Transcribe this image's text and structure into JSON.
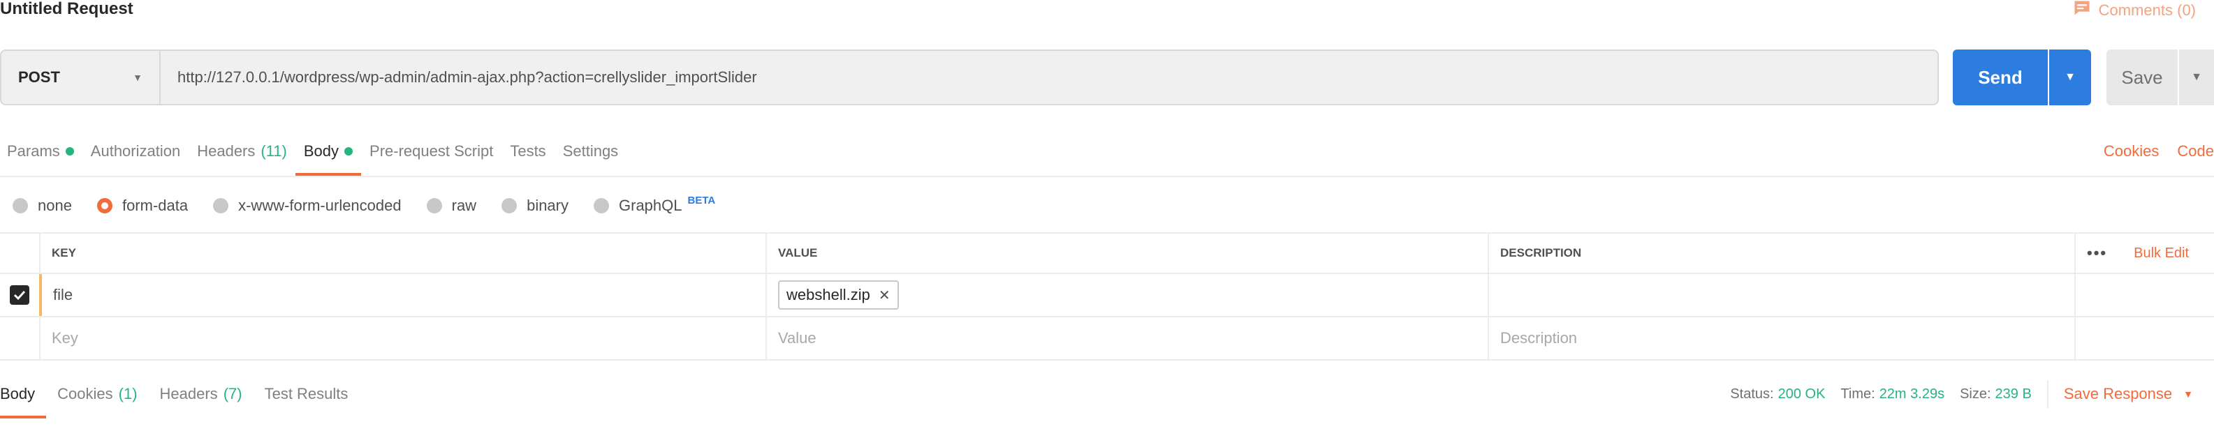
{
  "request": {
    "title": "Untitled Request",
    "comments_label": "Comments (0)"
  },
  "url_bar": {
    "method": "POST",
    "url": "http://127.0.0.1/wordpress/wp-admin/admin-ajax.php?action=crellyslider_importSlider",
    "send_label": "Send",
    "save_label": "Save"
  },
  "request_tabs": [
    {
      "label": "Params",
      "dot": true
    },
    {
      "label": "Authorization"
    },
    {
      "label": "Headers",
      "count": "(11)"
    },
    {
      "label": "Body",
      "dot": true,
      "active": true
    },
    {
      "label": "Pre-request Script"
    },
    {
      "label": "Tests"
    },
    {
      "label": "Settings"
    }
  ],
  "right_links": {
    "cookies": "Cookies",
    "code": "Code"
  },
  "body_types": [
    {
      "label": "none"
    },
    {
      "label": "form-data",
      "selected": true
    },
    {
      "label": "x-www-form-urlencoded"
    },
    {
      "label": "raw"
    },
    {
      "label": "binary"
    },
    {
      "label": "GraphQL",
      "badge": "BETA"
    }
  ],
  "params_table": {
    "headers": {
      "key": "KEY",
      "value": "VALUE",
      "description": "DESCRIPTION",
      "bulk_edit": "Bulk Edit",
      "more": "•••"
    },
    "rows": [
      {
        "key": "file",
        "value": "webshell.zip",
        "checked": true
      }
    ],
    "placeholders": {
      "key": "Key",
      "value": "Value",
      "description": "Description"
    }
  },
  "response_tabs": [
    {
      "label": "Body",
      "active": true
    },
    {
      "label": "Cookies",
      "count": "(1)"
    },
    {
      "label": "Headers",
      "count": "(7)"
    },
    {
      "label": "Test Results"
    }
  ],
  "response_status": {
    "status_label": "Status:",
    "status_value": "200 OK",
    "time_label": "Time:",
    "time_value": "22m 3.29s",
    "size_label": "Size:",
    "size_value": "239 B",
    "save_response": "Save Response"
  },
  "colors": {
    "accent": "#f26b3a",
    "primary": "#2d7de1",
    "success": "#26b47f"
  }
}
